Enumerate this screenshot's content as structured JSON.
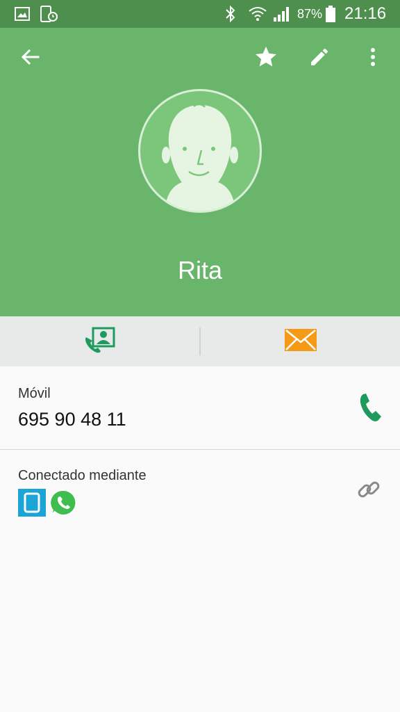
{
  "status_bar": {
    "battery_percent": "87%",
    "time": "21:16",
    "icons": [
      "gallery-icon",
      "screen-timer-icon",
      "bluetooth-icon",
      "wifi-icon",
      "signal-icon",
      "battery-icon"
    ]
  },
  "toolbar": {
    "icons": [
      "back-arrow-icon",
      "star-icon",
      "edit-pencil-icon",
      "more-options-icon"
    ]
  },
  "contact": {
    "name": "Rita"
  },
  "quick_actions": {
    "icons": [
      "call-contact-icon",
      "message-icon"
    ],
    "call_color": "#1e9a5c",
    "message_color": "#f49a14"
  },
  "phone": {
    "label": "Móvil",
    "number": "695 90 48 11"
  },
  "connections": {
    "label": "Conectado mediante",
    "apps": [
      "tablet-app-icon",
      "whatsapp-icon"
    ]
  },
  "colors": {
    "header": "#69b56b",
    "statusbar": "#4e8f4e",
    "accent": "#1e9a5c"
  }
}
